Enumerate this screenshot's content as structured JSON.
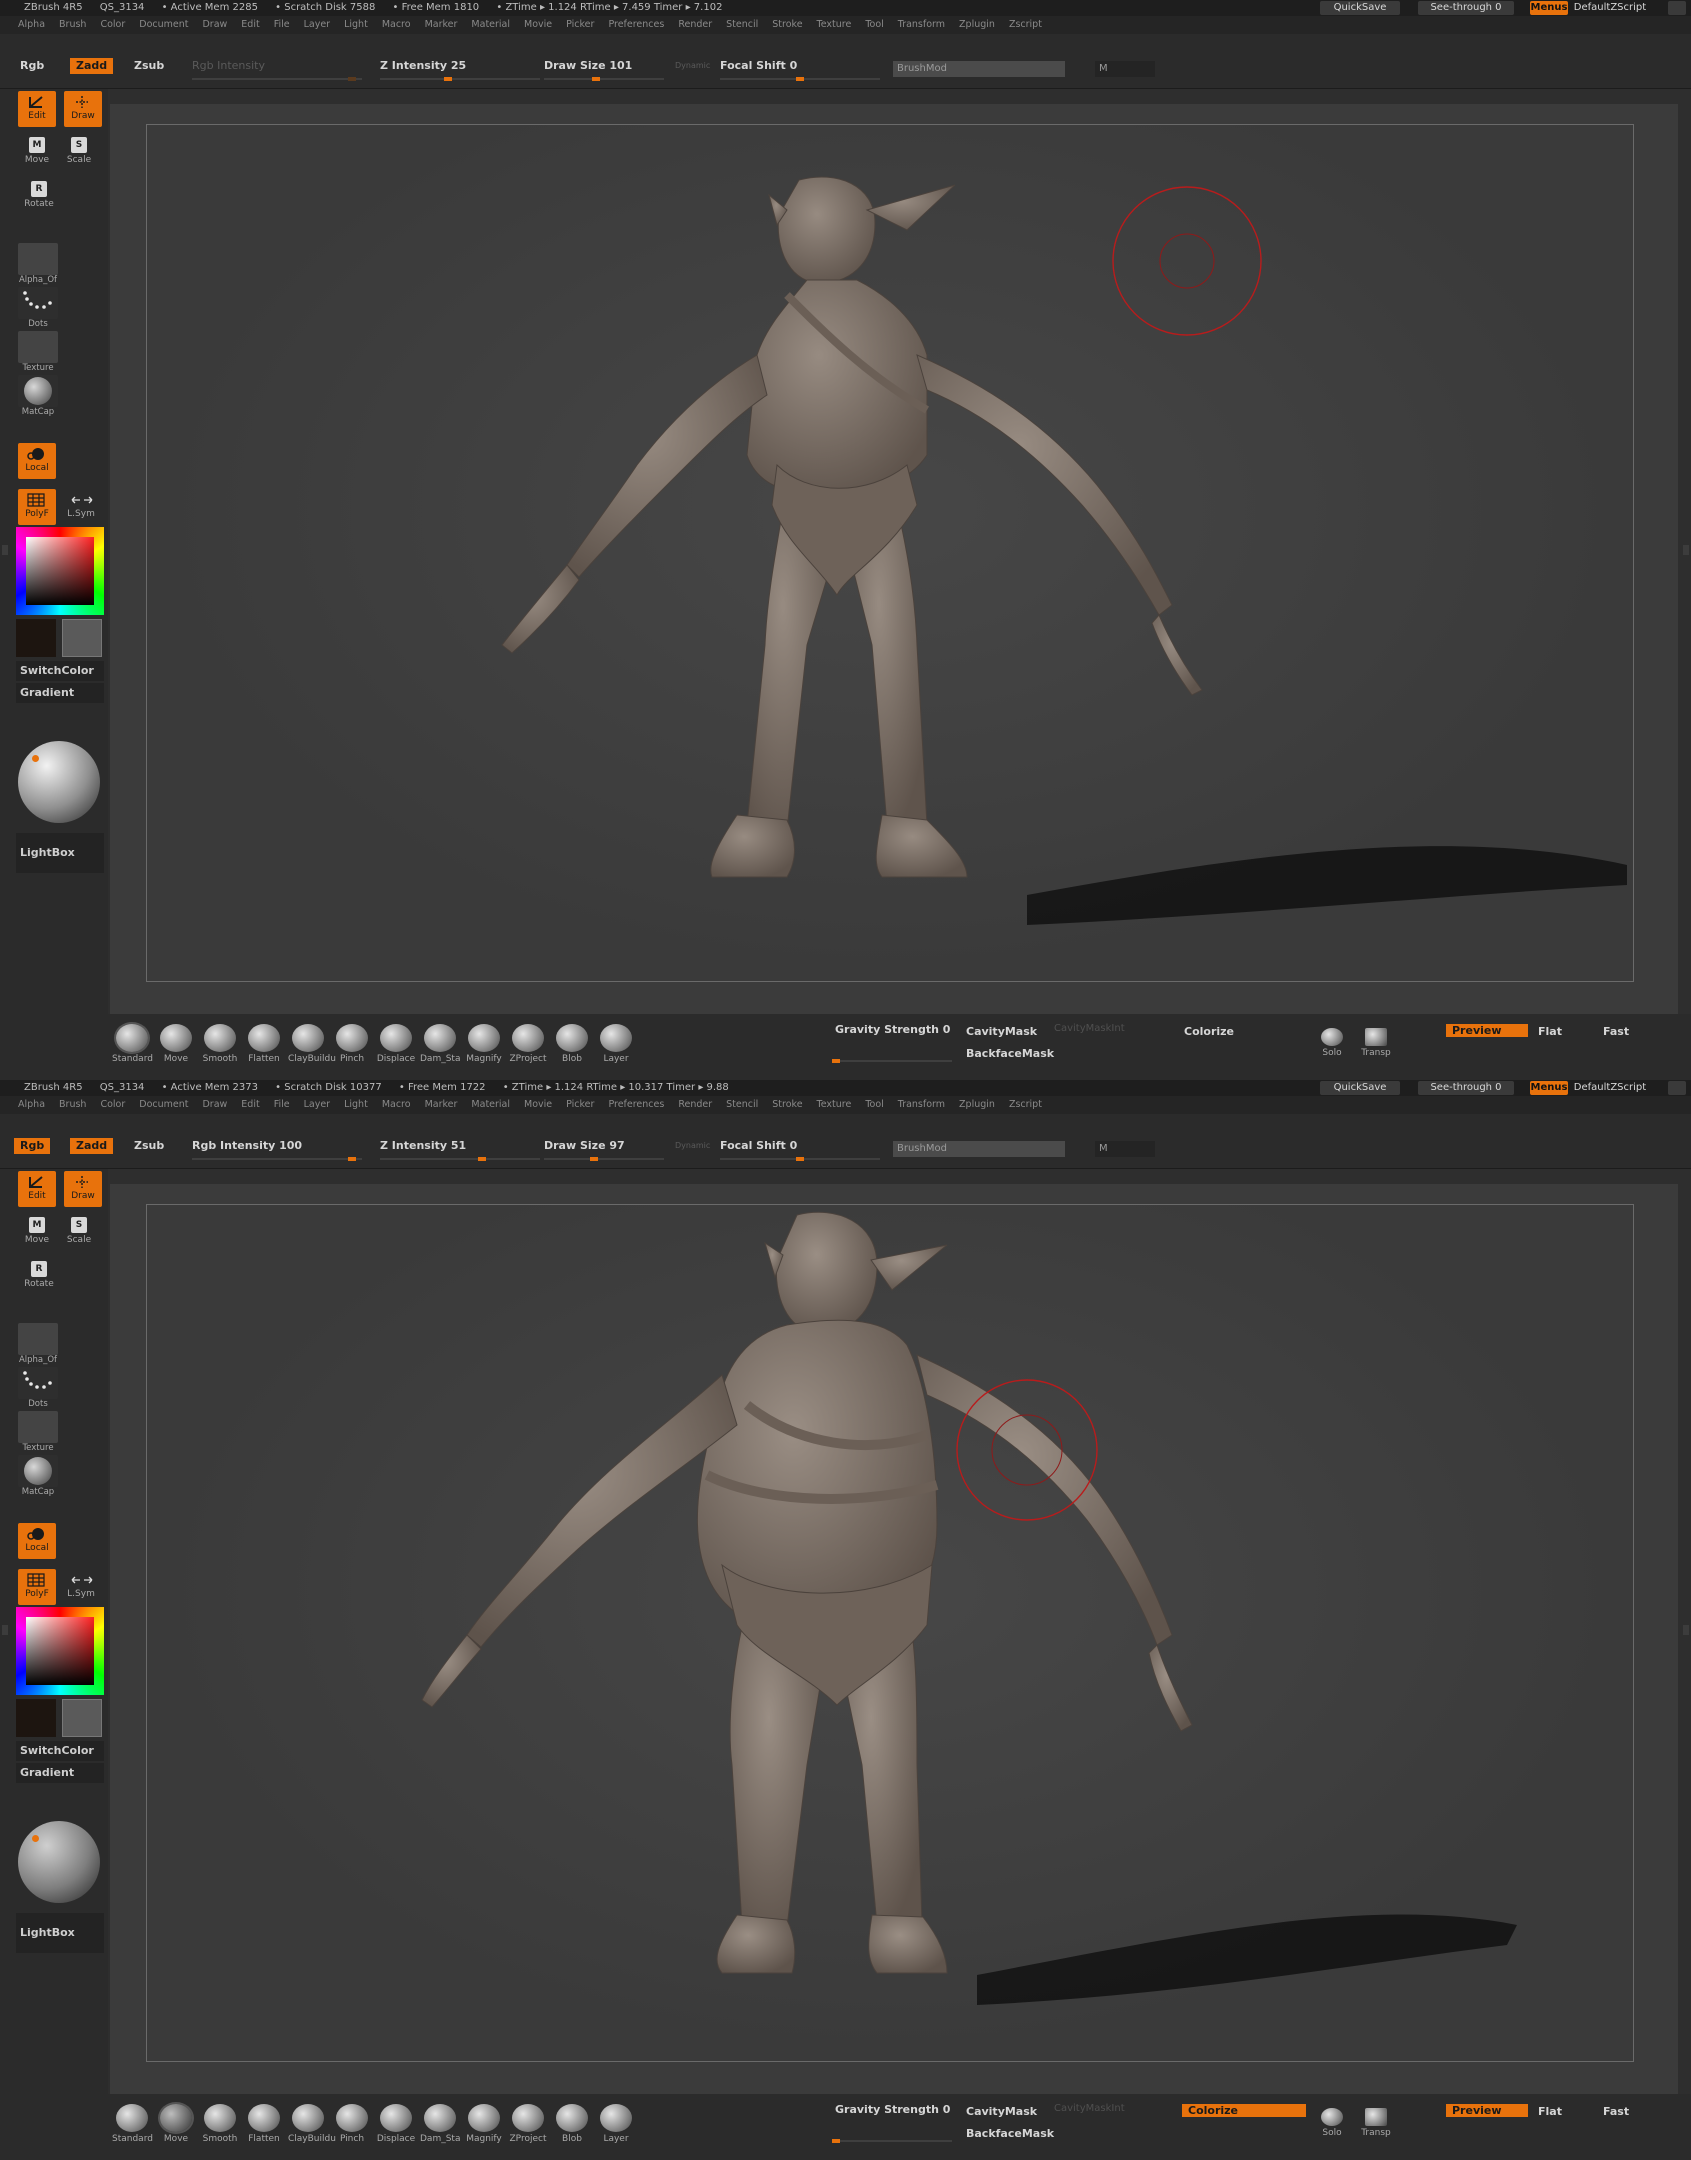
{
  "panels": [
    {
      "app_name": "ZBrush 4R5",
      "qs": "QS_3134",
      "active_mem": "• Active Mem 2285",
      "scratch_disk": "• Scratch Disk 7588",
      "free_mem": "• Free Mem 1810",
      "ztime": "• ZTime ▸ 1.124  RTime ▸ 7.459  Timer ▸ 7.102",
      "quicksave": "QuickSave",
      "see_through": "See-through  0",
      "menus": "Menus",
      "default_zscript": "DefaultZScript",
      "menu_items": [
        "Alpha",
        "Brush",
        "Color",
        "Document",
        "Draw",
        "Edit",
        "File",
        "Layer",
        "Light",
        "Macro",
        "Marker",
        "Material",
        "Movie",
        "Picker",
        "Preferences",
        "Render",
        "Stencil",
        "Stroke",
        "Texture",
        "Tool",
        "Transform",
        "Zplugin",
        "Zscript"
      ],
      "rgb": "Rgb",
      "zadd": "Zadd",
      "zsub": "Zsub",
      "rgb_intensity": "Rgb Intensity",
      "z_intensity": "Z Intensity 25",
      "draw_size": "Draw Size 101",
      "dynamic": "Dynamic",
      "focal_shift": "Focal Shift 0",
      "brushmod": "BrushMod",
      "m": "M",
      "left": {
        "edit": "Edit",
        "draw": "Draw",
        "move": "Move",
        "scale": "Scale",
        "rotate": "Rotate",
        "alpha": "Alpha_Of",
        "dots": "Dots",
        "texture": "Texture",
        "matcap": "MatCap",
        "local": "Local",
        "polyf": "PolyF",
        "lsym": "L.Sym",
        "switchcolor": "SwitchColor",
        "gradient": "Gradient",
        "lightbox": "LightBox"
      },
      "shelf": [
        "Standard",
        "Move",
        "Smooth",
        "Flatten",
        "ClayBuildu",
        "Pinch",
        "Displace",
        "Dam_Sta",
        "Magnify",
        "ZProject",
        "Blob",
        "Layer"
      ],
      "gravity": "Gravity Strength 0",
      "cavitymask": "CavityMask",
      "cavitymaskint": "CavityMaskInt",
      "colorize": "Colorize",
      "backfacemask": "BackfaceMask",
      "solo": "Solo",
      "transp": "Transp",
      "preview": "Preview",
      "flat": "Flat",
      "fast": "Fast"
    },
    {
      "app_name": "ZBrush 4R5",
      "qs": "QS_3134",
      "active_mem": "• Active Mem 2373",
      "scratch_disk": "• Scratch Disk 10377",
      "free_mem": "• Free Mem 1722",
      "ztime": "• ZTime ▸ 1.124  RTime ▸ 10.317  Timer ▸ 9.88",
      "quicksave": "QuickSave",
      "see_through": "See-through  0",
      "menus": "Menus",
      "default_zscript": "DefaultZScript",
      "menu_items": [
        "Alpha",
        "Brush",
        "Color",
        "Document",
        "Draw",
        "Edit",
        "File",
        "Layer",
        "Light",
        "Macro",
        "Marker",
        "Material",
        "Movie",
        "Picker",
        "Preferences",
        "Render",
        "Stencil",
        "Stroke",
        "Texture",
        "Tool",
        "Transform",
        "Zplugin",
        "Zscript"
      ],
      "rgb": "Rgb",
      "zadd": "Zadd",
      "zsub": "Zsub",
      "rgb_intensity": "Rgb Intensity 100",
      "z_intensity": "Z Intensity 51",
      "draw_size": "Draw Size 97",
      "dynamic": "Dynamic",
      "focal_shift": "Focal Shift 0",
      "brushmod": "BrushMod",
      "m": "M",
      "left": {
        "edit": "Edit",
        "draw": "Draw",
        "move": "Move",
        "scale": "Scale",
        "rotate": "Rotate",
        "alpha": "Alpha_Of",
        "dots": "Dots",
        "texture": "Texture",
        "matcap": "MatCap",
        "local": "Local",
        "polyf": "PolyF",
        "lsym": "L.Sym",
        "switchcolor": "SwitchColor",
        "gradient": "Gradient",
        "lightbox": "LightBox"
      },
      "shelf": [
        "Standard",
        "Move",
        "Smooth",
        "Flatten",
        "ClayBuildu",
        "Pinch",
        "Displace",
        "Dam_Sta",
        "Magnify",
        "ZProject",
        "Blob",
        "Layer"
      ],
      "gravity": "Gravity Strength 0",
      "cavitymask": "CavityMask",
      "cavitymaskint": "CavityMaskInt",
      "colorize": "Colorize",
      "backfacemask": "BackfaceMask",
      "solo": "Solo",
      "transp": "Transp",
      "preview": "Preview",
      "flat": "Flat",
      "fast": "Fast"
    }
  ],
  "colors": {
    "accent": "#e8720c",
    "brush_ring": "#b81c1c",
    "ui_bg": "#2e2e2e",
    "viewport_bg": "#404040",
    "skin": "#7f7168"
  }
}
